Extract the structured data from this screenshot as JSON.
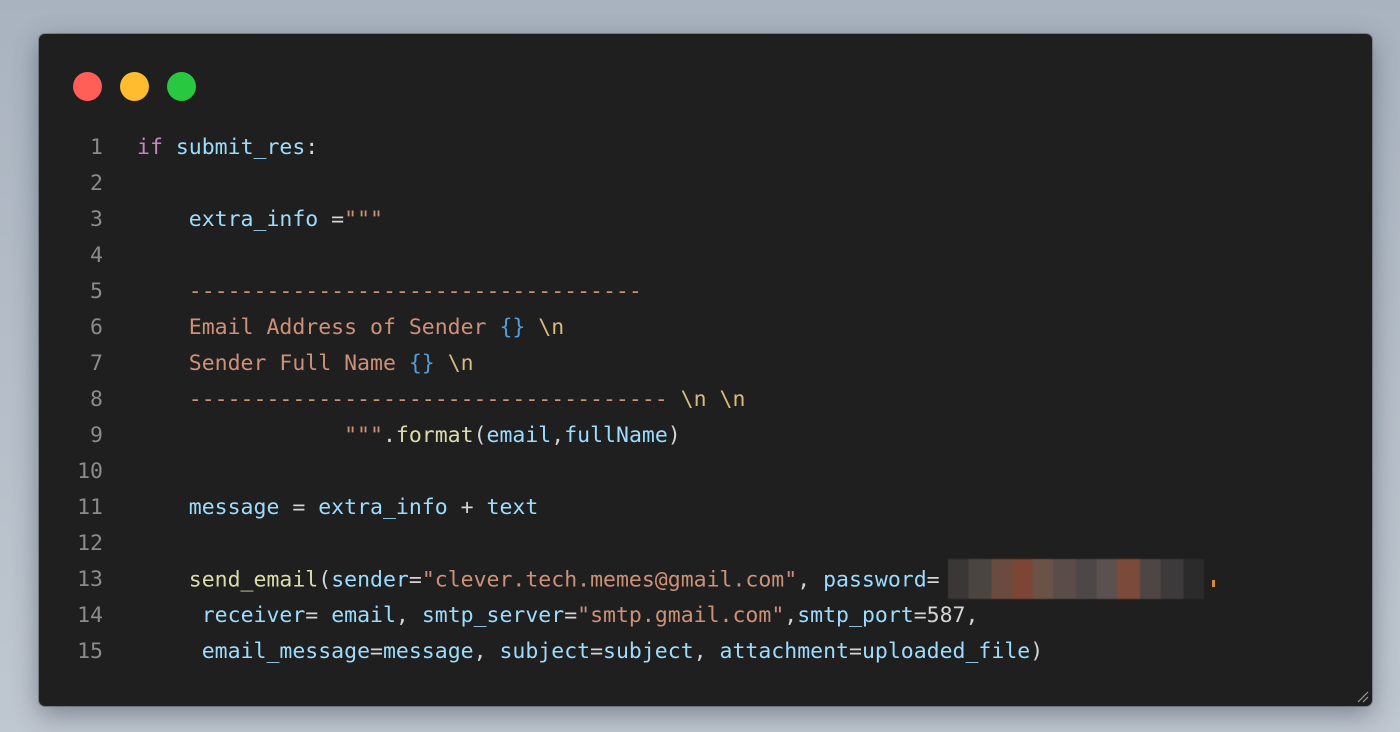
{
  "window": {
    "controls": [
      "close",
      "minimize",
      "zoom"
    ]
  },
  "code": {
    "lines": [
      {
        "num": "1",
        "tokens": [
          {
            "t": "if",
            "c": "kw"
          },
          {
            "t": " ",
            "c": "plain"
          },
          {
            "t": "submit_res",
            "c": "var"
          },
          {
            "t": ":",
            "c": "plain"
          }
        ]
      },
      {
        "num": "2",
        "tokens": []
      },
      {
        "num": "3",
        "tokens": [
          {
            "t": "    ",
            "c": "plain"
          },
          {
            "t": "extra_info",
            "c": "var"
          },
          {
            "t": " =",
            "c": "plain"
          },
          {
            "t": "\"\"\"",
            "c": "str"
          }
        ]
      },
      {
        "num": "4",
        "tokens": []
      },
      {
        "num": "5",
        "tokens": [
          {
            "t": "    ",
            "c": "plain"
          },
          {
            "t": "-----------------------------------",
            "c": "str"
          }
        ]
      },
      {
        "num": "6",
        "tokens": [
          {
            "t": "    ",
            "c": "plain"
          },
          {
            "t": "Email Address of Sender ",
            "c": "str"
          },
          {
            "t": "{}",
            "c": "brace"
          },
          {
            "t": " ",
            "c": "str"
          },
          {
            "t": "\\n",
            "c": "esc"
          }
        ]
      },
      {
        "num": "7",
        "tokens": [
          {
            "t": "    ",
            "c": "plain"
          },
          {
            "t": "Sender Full Name ",
            "c": "str"
          },
          {
            "t": "{}",
            "c": "brace"
          },
          {
            "t": " ",
            "c": "str"
          },
          {
            "t": "\\n",
            "c": "esc"
          }
        ]
      },
      {
        "num": "8",
        "tokens": [
          {
            "t": "    ",
            "c": "plain"
          },
          {
            "t": "------------------------------------- ",
            "c": "str"
          },
          {
            "t": "\\n",
            "c": "esc"
          },
          {
            "t": " ",
            "c": "str"
          },
          {
            "t": "\\n",
            "c": "esc"
          }
        ]
      },
      {
        "num": "9",
        "tokens": [
          {
            "t": "                ",
            "c": "plain"
          },
          {
            "t": "\"\"\"",
            "c": "str"
          },
          {
            "t": ".",
            "c": "plain"
          },
          {
            "t": "format",
            "c": "fn"
          },
          {
            "t": "(",
            "c": "plain"
          },
          {
            "t": "email",
            "c": "var"
          },
          {
            "t": ",",
            "c": "plain"
          },
          {
            "t": "fullName",
            "c": "var"
          },
          {
            "t": ")",
            "c": "plain"
          }
        ]
      },
      {
        "num": "10",
        "tokens": []
      },
      {
        "num": "11",
        "tokens": [
          {
            "t": "    ",
            "c": "plain"
          },
          {
            "t": "message",
            "c": "var"
          },
          {
            "t": " = ",
            "c": "plain"
          },
          {
            "t": "extra_info",
            "c": "var"
          },
          {
            "t": " + ",
            "c": "plain"
          },
          {
            "t": "text",
            "c": "var"
          }
        ]
      },
      {
        "num": "12",
        "tokens": []
      },
      {
        "num": "13",
        "tokens": [
          {
            "t": "    ",
            "c": "plain"
          },
          {
            "t": "send_email",
            "c": "fn"
          },
          {
            "t": "(",
            "c": "plain"
          },
          {
            "t": "sender",
            "c": "var"
          },
          {
            "t": "=",
            "c": "plain"
          },
          {
            "t": "\"clever.tech.memes@gmail.com\"",
            "c": "str"
          },
          {
            "t": ", ",
            "c": "plain"
          },
          {
            "t": "password",
            "c": "var"
          },
          {
            "t": "=",
            "c": "plain"
          }
        ],
        "redacted": true
      },
      {
        "num": "14",
        "tokens": [
          {
            "t": "     ",
            "c": "plain"
          },
          {
            "t": "receiver",
            "c": "var"
          },
          {
            "t": "= ",
            "c": "plain"
          },
          {
            "t": "email",
            "c": "var"
          },
          {
            "t": ", ",
            "c": "plain"
          },
          {
            "t": "smtp_server",
            "c": "var"
          },
          {
            "t": "=",
            "c": "plain"
          },
          {
            "t": "\"smtp.gmail.com\"",
            "c": "str"
          },
          {
            "t": ",",
            "c": "plain"
          },
          {
            "t": "smtp_port",
            "c": "var"
          },
          {
            "t": "=587,",
            "c": "plain"
          }
        ]
      },
      {
        "num": "15",
        "tokens": [
          {
            "t": "     ",
            "c": "plain"
          },
          {
            "t": "email_message",
            "c": "var"
          },
          {
            "t": "=",
            "c": "plain"
          },
          {
            "t": "message",
            "c": "var"
          },
          {
            "t": ", ",
            "c": "plain"
          },
          {
            "t": "subject",
            "c": "var"
          },
          {
            "t": "=",
            "c": "plain"
          },
          {
            "t": "subject",
            "c": "var"
          },
          {
            "t": ", ",
            "c": "plain"
          },
          {
            "t": "attachment",
            "c": "var"
          },
          {
            "t": "=",
            "c": "plain"
          },
          {
            "t": "uploaded_file",
            "c": "var"
          },
          {
            "t": ")",
            "c": "plain"
          }
        ]
      }
    ]
  }
}
